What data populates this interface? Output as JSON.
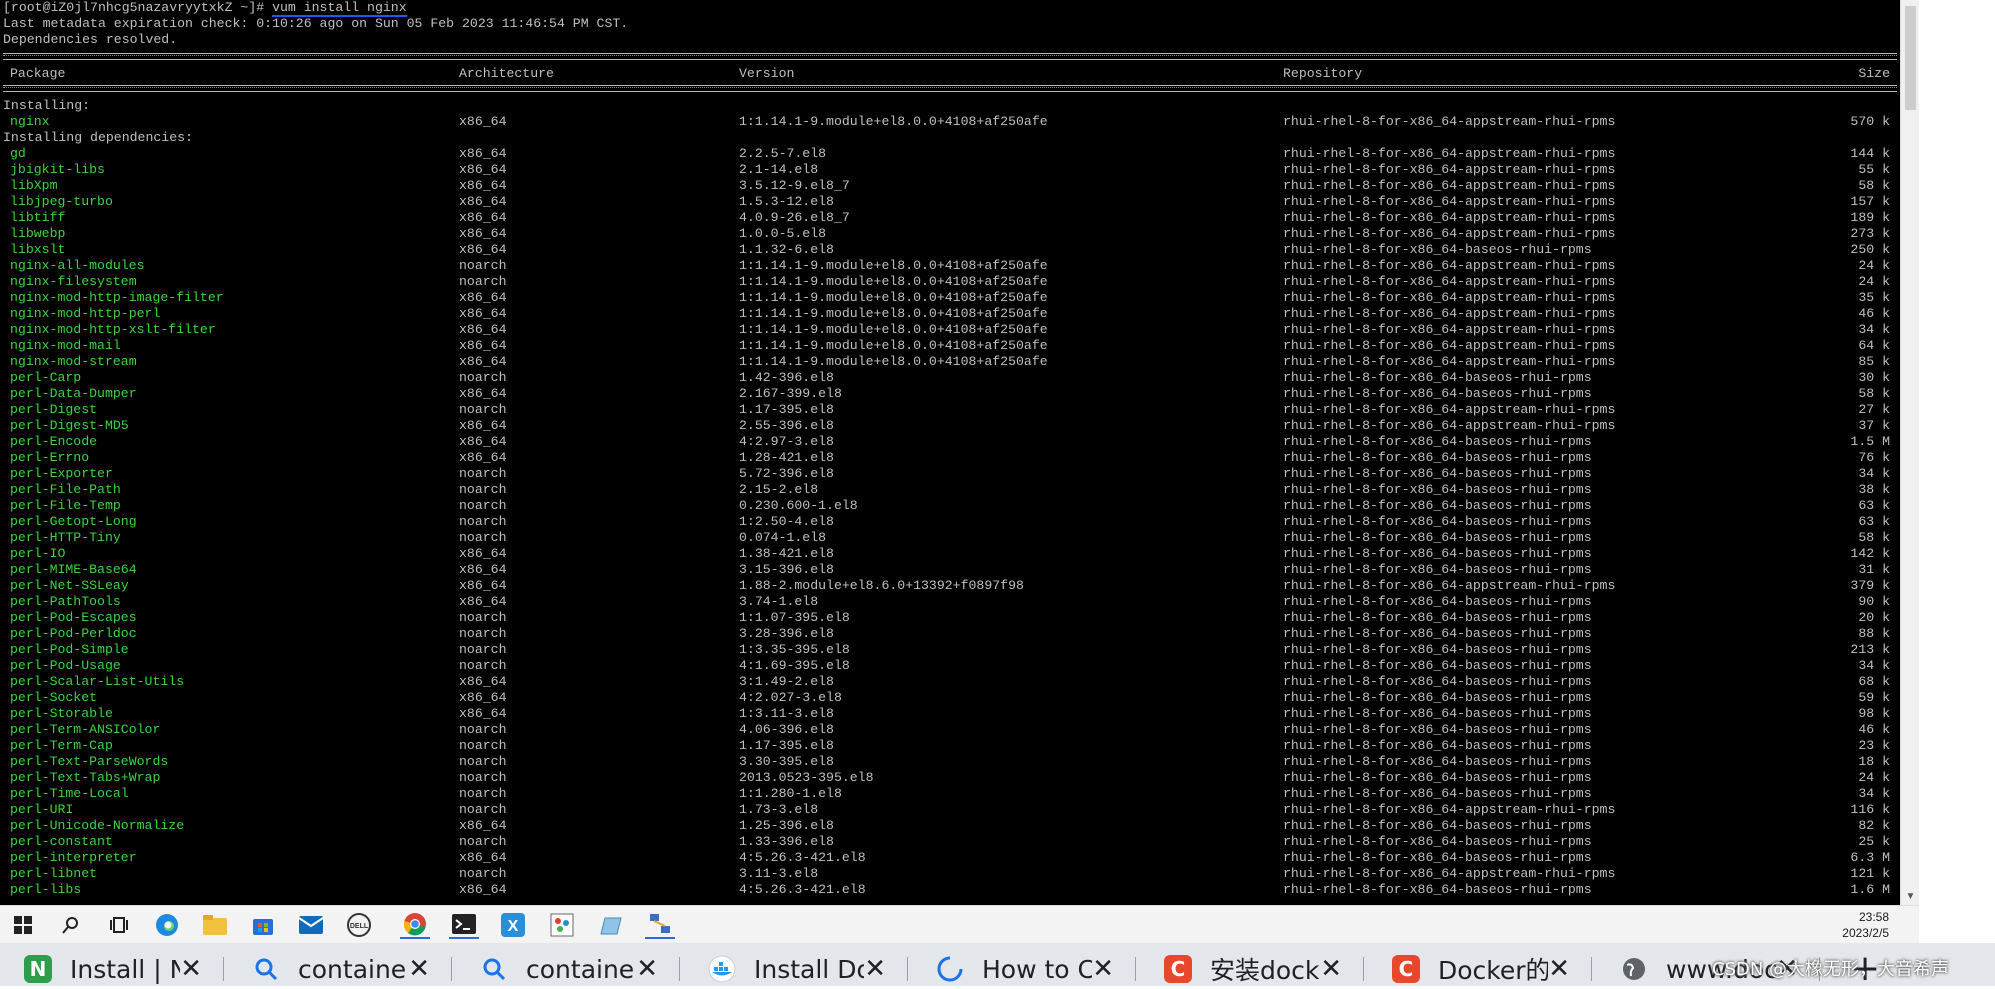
{
  "terminal": {
    "prompt": "[root@iZ0jl7nhcg5nazavryytxkZ ~]# ",
    "command": "vum install nginx",
    "line2": "Last metadata expiration check: 0:10:26 ago on Sun 05 Feb 2023 11:46:54 PM CST.",
    "line3": "Dependencies resolved.",
    "headers": {
      "package": "Package",
      "arch": "Architecture",
      "version": "Version",
      "repo": "Repository",
      "size": "Size"
    },
    "installing_label": "Installing:",
    "deps_label": "Installing dependencies:",
    "installing": [
      {
        "package": "nginx",
        "arch": "x86_64",
        "version": "1:1.14.1-9.module+el8.0.0+4108+af250afe",
        "repo": "rhui-rhel-8-for-x86_64-appstream-rhui-rpms",
        "size": "570 k"
      }
    ],
    "dependencies": [
      {
        "package": "gd",
        "arch": "x86_64",
        "version": "2.2.5-7.el8",
        "repo": "rhui-rhel-8-for-x86_64-appstream-rhui-rpms",
        "size": "144 k"
      },
      {
        "package": "jbigkit-libs",
        "arch": "x86_64",
        "version": "2.1-14.el8",
        "repo": "rhui-rhel-8-for-x86_64-appstream-rhui-rpms",
        "size": "55 k"
      },
      {
        "package": "libXpm",
        "arch": "x86_64",
        "version": "3.5.12-9.el8_7",
        "repo": "rhui-rhel-8-for-x86_64-appstream-rhui-rpms",
        "size": "58 k"
      },
      {
        "package": "libjpeg-turbo",
        "arch": "x86_64",
        "version": "1.5.3-12.el8",
        "repo": "rhui-rhel-8-for-x86_64-appstream-rhui-rpms",
        "size": "157 k"
      },
      {
        "package": "libtiff",
        "arch": "x86_64",
        "version": "4.0.9-26.el8_7",
        "repo": "rhui-rhel-8-for-x86_64-appstream-rhui-rpms",
        "size": "189 k"
      },
      {
        "package": "libwebp",
        "arch": "x86_64",
        "version": "1.0.0-5.el8",
        "repo": "rhui-rhel-8-for-x86_64-appstream-rhui-rpms",
        "size": "273 k"
      },
      {
        "package": "libxslt",
        "arch": "x86_64",
        "version": "1.1.32-6.el8",
        "repo": "rhui-rhel-8-for-x86_64-baseos-rhui-rpms",
        "size": "250 k"
      },
      {
        "package": "nginx-all-modules",
        "arch": "noarch",
        "version": "1:1.14.1-9.module+el8.0.0+4108+af250afe",
        "repo": "rhui-rhel-8-for-x86_64-appstream-rhui-rpms",
        "size": "24 k"
      },
      {
        "package": "nginx-filesystem",
        "arch": "noarch",
        "version": "1:1.14.1-9.module+el8.0.0+4108+af250afe",
        "repo": "rhui-rhel-8-for-x86_64-appstream-rhui-rpms",
        "size": "24 k"
      },
      {
        "package": "nginx-mod-http-image-filter",
        "arch": "x86_64",
        "version": "1:1.14.1-9.module+el8.0.0+4108+af250afe",
        "repo": "rhui-rhel-8-for-x86_64-appstream-rhui-rpms",
        "size": "35 k"
      },
      {
        "package": "nginx-mod-http-perl",
        "arch": "x86_64",
        "version": "1:1.14.1-9.module+el8.0.0+4108+af250afe",
        "repo": "rhui-rhel-8-for-x86_64-appstream-rhui-rpms",
        "size": "46 k"
      },
      {
        "package": "nginx-mod-http-xslt-filter",
        "arch": "x86_64",
        "version": "1:1.14.1-9.module+el8.0.0+4108+af250afe",
        "repo": "rhui-rhel-8-for-x86_64-appstream-rhui-rpms",
        "size": "34 k"
      },
      {
        "package": "nginx-mod-mail",
        "arch": "x86_64",
        "version": "1:1.14.1-9.module+el8.0.0+4108+af250afe",
        "repo": "rhui-rhel-8-for-x86_64-appstream-rhui-rpms",
        "size": "64 k"
      },
      {
        "package": "nginx-mod-stream",
        "arch": "x86_64",
        "version": "1:1.14.1-9.module+el8.0.0+4108+af250afe",
        "repo": "rhui-rhel-8-for-x86_64-appstream-rhui-rpms",
        "size": "85 k"
      },
      {
        "package": "perl-Carp",
        "arch": "noarch",
        "version": "1.42-396.el8",
        "repo": "rhui-rhel-8-for-x86_64-baseos-rhui-rpms",
        "size": "30 k"
      },
      {
        "package": "perl-Data-Dumper",
        "arch": "x86_64",
        "version": "2.167-399.el8",
        "repo": "rhui-rhel-8-for-x86_64-baseos-rhui-rpms",
        "size": "58 k"
      },
      {
        "package": "perl-Digest",
        "arch": "noarch",
        "version": "1.17-395.el8",
        "repo": "rhui-rhel-8-for-x86_64-appstream-rhui-rpms",
        "size": "27 k"
      },
      {
        "package": "perl-Digest-MD5",
        "arch": "x86_64",
        "version": "2.55-396.el8",
        "repo": "rhui-rhel-8-for-x86_64-appstream-rhui-rpms",
        "size": "37 k"
      },
      {
        "package": "perl-Encode",
        "arch": "x86_64",
        "version": "4:2.97-3.el8",
        "repo": "rhui-rhel-8-for-x86_64-baseos-rhui-rpms",
        "size": "1.5 M"
      },
      {
        "package": "perl-Errno",
        "arch": "x86_64",
        "version": "1.28-421.el8",
        "repo": "rhui-rhel-8-for-x86_64-baseos-rhui-rpms",
        "size": "76 k"
      },
      {
        "package": "perl-Exporter",
        "arch": "noarch",
        "version": "5.72-396.el8",
        "repo": "rhui-rhel-8-for-x86_64-baseos-rhui-rpms",
        "size": "34 k"
      },
      {
        "package": "perl-File-Path",
        "arch": "noarch",
        "version": "2.15-2.el8",
        "repo": "rhui-rhel-8-for-x86_64-baseos-rhui-rpms",
        "size": "38 k"
      },
      {
        "package": "perl-File-Temp",
        "arch": "noarch",
        "version": "0.230.600-1.el8",
        "repo": "rhui-rhel-8-for-x86_64-baseos-rhui-rpms",
        "size": "63 k"
      },
      {
        "package": "perl-Getopt-Long",
        "arch": "noarch",
        "version": "1:2.50-4.el8",
        "repo": "rhui-rhel-8-for-x86_64-baseos-rhui-rpms",
        "size": "63 k"
      },
      {
        "package": "perl-HTTP-Tiny",
        "arch": "noarch",
        "version": "0.074-1.el8",
        "repo": "rhui-rhel-8-for-x86_64-baseos-rhui-rpms",
        "size": "58 k"
      },
      {
        "package": "perl-IO",
        "arch": "x86_64",
        "version": "1.38-421.el8",
        "repo": "rhui-rhel-8-for-x86_64-baseos-rhui-rpms",
        "size": "142 k"
      },
      {
        "package": "perl-MIME-Base64",
        "arch": "x86_64",
        "version": "3.15-396.el8",
        "repo": "rhui-rhel-8-for-x86_64-baseos-rhui-rpms",
        "size": "31 k"
      },
      {
        "package": "perl-Net-SSLeay",
        "arch": "x86_64",
        "version": "1.88-2.module+el8.6.0+13392+f0897f98",
        "repo": "rhui-rhel-8-for-x86_64-appstream-rhui-rpms",
        "size": "379 k"
      },
      {
        "package": "perl-PathTools",
        "arch": "x86_64",
        "version": "3.74-1.el8",
        "repo": "rhui-rhel-8-for-x86_64-baseos-rhui-rpms",
        "size": "90 k"
      },
      {
        "package": "perl-Pod-Escapes",
        "arch": "noarch",
        "version": "1:1.07-395.el8",
        "repo": "rhui-rhel-8-for-x86_64-baseos-rhui-rpms",
        "size": "20 k"
      },
      {
        "package": "perl-Pod-Perldoc",
        "arch": "noarch",
        "version": "3.28-396.el8",
        "repo": "rhui-rhel-8-for-x86_64-baseos-rhui-rpms",
        "size": "88 k"
      },
      {
        "package": "perl-Pod-Simple",
        "arch": "noarch",
        "version": "1:3.35-395.el8",
        "repo": "rhui-rhel-8-for-x86_64-baseos-rhui-rpms",
        "size": "213 k"
      },
      {
        "package": "perl-Pod-Usage",
        "arch": "noarch",
        "version": "4:1.69-395.el8",
        "repo": "rhui-rhel-8-for-x86_64-baseos-rhui-rpms",
        "size": "34 k"
      },
      {
        "package": "perl-Scalar-List-Utils",
        "arch": "x86_64",
        "version": "3:1.49-2.el8",
        "repo": "rhui-rhel-8-for-x86_64-baseos-rhui-rpms",
        "size": "68 k"
      },
      {
        "package": "perl-Socket",
        "arch": "x86_64",
        "version": "4:2.027-3.el8",
        "repo": "rhui-rhel-8-for-x86_64-baseos-rhui-rpms",
        "size": "59 k"
      },
      {
        "package": "perl-Storable",
        "arch": "x86_64",
        "version": "1:3.11-3.el8",
        "repo": "rhui-rhel-8-for-x86_64-baseos-rhui-rpms",
        "size": "98 k"
      },
      {
        "package": "perl-Term-ANSIColor",
        "arch": "noarch",
        "version": "4.06-396.el8",
        "repo": "rhui-rhel-8-for-x86_64-baseos-rhui-rpms",
        "size": "46 k"
      },
      {
        "package": "perl-Term-Cap",
        "arch": "noarch",
        "version": "1.17-395.el8",
        "repo": "rhui-rhel-8-for-x86_64-baseos-rhui-rpms",
        "size": "23 k"
      },
      {
        "package": "perl-Text-ParseWords",
        "arch": "noarch",
        "version": "3.30-395.el8",
        "repo": "rhui-rhel-8-for-x86_64-baseos-rhui-rpms",
        "size": "18 k"
      },
      {
        "package": "perl-Text-Tabs+Wrap",
        "arch": "noarch",
        "version": "2013.0523-395.el8",
        "repo": "rhui-rhel-8-for-x86_64-baseos-rhui-rpms",
        "size": "24 k"
      },
      {
        "package": "perl-Time-Local",
        "arch": "noarch",
        "version": "1:1.280-1.el8",
        "repo": "rhui-rhel-8-for-x86_64-baseos-rhui-rpms",
        "size": "34 k"
      },
      {
        "package": "perl-URI",
        "arch": "noarch",
        "version": "1.73-3.el8",
        "repo": "rhui-rhel-8-for-x86_64-appstream-rhui-rpms",
        "size": "116 k"
      },
      {
        "package": "perl-Unicode-Normalize",
        "arch": "x86_64",
        "version": "1.25-396.el8",
        "repo": "rhui-rhel-8-for-x86_64-baseos-rhui-rpms",
        "size": "82 k"
      },
      {
        "package": "perl-constant",
        "arch": "noarch",
        "version": "1.33-396.el8",
        "repo": "rhui-rhel-8-for-x86_64-baseos-rhui-rpms",
        "size": "25 k"
      },
      {
        "package": "perl-interpreter",
        "arch": "x86_64",
        "version": "4:5.26.3-421.el8",
        "repo": "rhui-rhel-8-for-x86_64-baseos-rhui-rpms",
        "size": "6.3 M"
      },
      {
        "package": "perl-libnet",
        "arch": "noarch",
        "version": "3.11-3.el8",
        "repo": "rhui-rhel-8-for-x86_64-appstream-rhui-rpms",
        "size": "121 k"
      },
      {
        "package": "perl-libs",
        "arch": "x86_64",
        "version": "4:5.26.3-421.el8",
        "repo": "rhui-rhel-8-for-x86_64-baseos-rhui-rpms",
        "size": "1.6 M"
      }
    ]
  },
  "taskbar": {
    "icons": [
      "windows-start-icon",
      "search-icon",
      "task-view-icon",
      "edge-icon",
      "file-explorer-icon",
      "store-icon",
      "mail-icon",
      "dell-icon",
      "chrome-icon",
      "terminal-icon",
      "xshell-icon",
      "paint-icon",
      "files-icon",
      "network-icon"
    ],
    "time": "23:58",
    "date": "2023/2/5"
  },
  "browser_tabs": [
    {
      "title": "Install | N",
      "favicon": "N",
      "color": "#2e9e4a"
    },
    {
      "title": "containe",
      "favicon": "search",
      "color": "#1a73e8"
    },
    {
      "title": "containe",
      "favicon": "search",
      "color": "#1a73e8"
    },
    {
      "title": "Install Do",
      "favicon": "docker",
      "color": "#2496ed"
    },
    {
      "title": "How to C",
      "favicon": "loading",
      "color": "#1a73e8"
    },
    {
      "title": "安装dock",
      "favicon": "C",
      "color": "#e8472b"
    },
    {
      "title": "Docker的",
      "favicon": "C",
      "color": "#e8472b"
    },
    {
      "title": "www.doc",
      "favicon": "globe",
      "color": "#5f6368"
    }
  ],
  "new_tab_label": "+",
  "watermark": "CSDN @大橡无形，大音希声",
  "colors": {
    "terminal_bg": "#000000",
    "package_green": "#3ad63a",
    "text": "#c0c0c0",
    "command_underline": "#2255ff"
  }
}
